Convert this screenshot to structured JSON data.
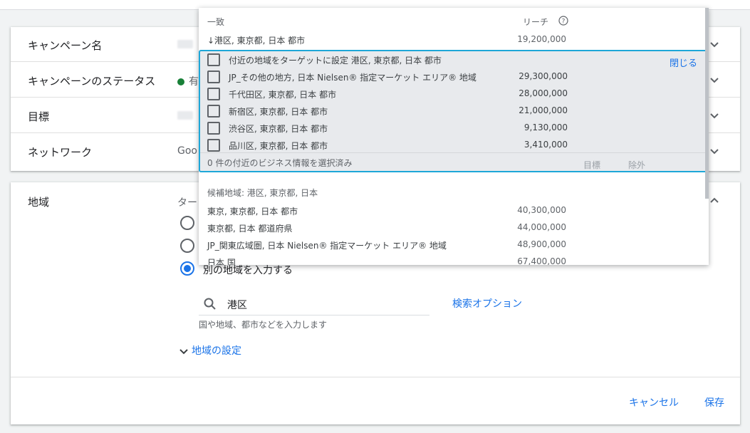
{
  "campaign": {
    "rows": [
      {
        "label": "キャンペーン名"
      },
      {
        "label": "キャンペーンのステータス",
        "value": "有"
      },
      {
        "label": "目標"
      },
      {
        "label": "ネットワーク",
        "value": "Goo"
      }
    ]
  },
  "location": {
    "section_label": "地域",
    "target_label": "ター",
    "radio_selected_label": "別の地域を入力する",
    "search_value": "港区",
    "search_options_label": "検索オプション",
    "hint": "国や地域、都市などを入力します",
    "settings_label": "地域の設定"
  },
  "footer": {
    "cancel": "キャンセル",
    "save": "保存"
  },
  "dropdown": {
    "header": "一致",
    "reach_label": "リーチ",
    "exact_match": {
      "text": "↓港区, 東京都, 日本 都市",
      "reach": "19,200,000"
    },
    "nearby": {
      "title": "付近の地域をターゲットに設定 港区, 東京都, 日本 都市",
      "close": "閉じる",
      "items": [
        {
          "text": "JP_その他の地方, 日本 Nielsen® 指定マーケット エリア® 地域",
          "reach": "29,300,000"
        },
        {
          "text": "千代田区, 東京都, 日本 都市",
          "reach": "28,000,000"
        },
        {
          "text": "新宿区, 東京都, 日本 都市",
          "reach": "21,000,000"
        },
        {
          "text": "渋谷区, 東京都, 日本 都市",
          "reach": "9,130,000"
        },
        {
          "text": "品川区, 東京都, 日本 都市",
          "reach": "3,410,000"
        }
      ],
      "footer": "0 件の付近のビジネス情報を選択済み",
      "target": "目標",
      "exclude": "除外"
    },
    "suggestions_header": "候補地域: 港区, 東京都, 日本",
    "suggestions": [
      {
        "text": "東京, 東京都, 日本 都市",
        "reach": "40,300,000"
      },
      {
        "text": "東京都, 日本 都道府県",
        "reach": "44,000,000"
      },
      {
        "text": "JP_関東広域圏, 日本 Nielsen® 指定マーケット エリア® 地域",
        "reach": "48,900,000"
      },
      {
        "text": "日本 国",
        "reach": "67,400,000"
      }
    ]
  },
  "colors": {
    "accent": "#1a73e8",
    "highlight_border": "#1ea7d8",
    "status_green": "#188038"
  }
}
